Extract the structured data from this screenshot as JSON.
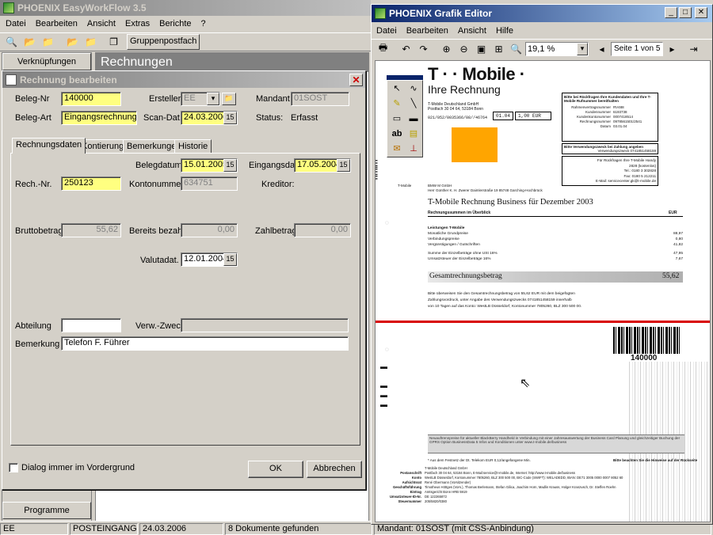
{
  "app": {
    "title": "PHOENIX EasyWorkFlow 3.5",
    "menu": [
      "Datei",
      "Bearbeiten",
      "Ansicht",
      "Extras",
      "Berichte",
      "?"
    ],
    "toolbar_label": "Gruppenpostfach",
    "sidebar_header": "Verknüpfungen",
    "sidebar_footer": "Programme",
    "panel_title": "Rechnungen",
    "status": [
      "EE",
      "POSTEINGANG",
      "24.03.2006",
      "8 Dokumente gefunden",
      "Mandant: 01SOST (mit CSS-Anbindung)"
    ]
  },
  "dialog": {
    "title": "Rechnung bearbeiten",
    "beleg_nr_label": "Beleg-Nr",
    "beleg_nr": "140000",
    "ersteller_label": "Ersteller",
    "ersteller": "EE",
    "mandant_label": "Mandant",
    "mandant": "01SOST",
    "beleg_art_label": "Beleg-Art",
    "beleg_art": "Eingangsrechnung",
    "scan_dat_label": "Scan-Dat.",
    "scan_dat": "24.03.2006",
    "status_label": "Status:",
    "status": "Erfasst",
    "tabs": [
      "Rechnungsdaten",
      "Kontierung",
      "Bemerkungen",
      "Historie"
    ],
    "belegdatum_label": "Belegdatum",
    "belegdatum": "15.01.2005",
    "eingangsdat_label": "Eingangsdat.",
    "eingangsdat": "17.05.2004",
    "rech_nr_label": "Rech.-Nr.",
    "rech_nr": "250123",
    "kontonummer_label": "Kontonummer",
    "kontonummer": "634751",
    "kreditor_label": "Kreditor:",
    "brutto_label": "Bruttobetrag",
    "brutto": "55,62",
    "bezahlt_label": "Bereits bezahlt",
    "bezahlt": "0,00",
    "zahlbetrag_label": "Zahlbetrag",
    "zahlbetrag": "0,00",
    "valutadat_label": "Valutadat.",
    "valutadat": "12.01.2004",
    "abteilung_label": "Abteilung",
    "abteilung": "",
    "verw_zweck_label": "Verw.-Zweck",
    "verw_zweck": "",
    "bemerkung_label": "Bemerkung",
    "bemerkung": "Telefon F. Führer",
    "checkbox_label": "Dialog immer im Vordergrund",
    "checkbox_checked": false,
    "ok_label": "OK",
    "cancel_label": "Abbrechen",
    "cal_glyph": "15"
  },
  "editor": {
    "title": "PHOENIX Grafik Editor",
    "menu": [
      "Datei",
      "Bearbeiten",
      "Ansicht",
      "Hilfe"
    ],
    "zoom": "19,1 %",
    "page": "Seite 1 von 5"
  },
  "invoice": {
    "brand": "T · · Mobile ·",
    "heading": "Ihre Rechnung",
    "sender": "T-Mobile Deutschland GmbH",
    "sender_addr": "Postfach 30 04 64, 53184 Bonn",
    "ref_line": "021/052/0035366/08//46764",
    "ref_box_a": "01.04",
    "ref_box_b": "1,00 EUR",
    "info_box_title": "Bitte bei Rückfragen Ihre Kundendaten und Ihre T-Mobile Rufnummer bereithalten",
    "info_rows": [
      [
        "Rahmenvertragsnummer",
        "RV488"
      ],
      [
        "Kundennummer",
        "6193738"
      ],
      [
        "Kundenkontonummer",
        "0007418514"
      ],
      [
        "Rechnungsnummer",
        "0978561501/2541"
      ],
      [
        "Datum",
        "03.01.04"
      ]
    ],
    "purpose_title": "Bitte Verwendungszweck bei Zahlung angeben",
    "purpose_value": "Verwendungszweck 0741851458159",
    "contact_lines": [
      "Für Rückfragen Ihre T-Mobile Handy",
      "2828 (kostenlos)",
      "Tel.: 0180 3 302828",
      "Fax: 0180 5 212211",
      "E-Mail: servicecenter.gk@t-mobile.de"
    ],
    "recipient_label": "T-Mobile",
    "recipient": "BMW M GmbH",
    "recipient_contact": "Herr Günther K. H. Zwerer Daimlerstraße 19 85748 Garching-Hochbrück",
    "business_title": "T-Mobile Rechnung Business für Dezember 2003",
    "summary_title": "Rechnungssummen im Überblick",
    "currency": "EUR",
    "lines": [
      [
        "Leistungen T-Mobile",
        "",
        true
      ],
      [
        "Monatliche Grundpreise",
        "88,97",
        false
      ],
      [
        "Verbindungspreise",
        "0,80",
        false
      ],
      [
        "Vergünstigungen / Gutschriften",
        "41,82",
        false
      ],
      [
        "Summe der Einzelbeträge ohne USt 16%",
        "47,95",
        false
      ],
      [
        "Umsatzsteuer der Einzelbeträge 16%",
        "7,67",
        false
      ]
    ],
    "total_label": "Gesamtrechnungsbetrag",
    "total_value": "55,62",
    "payment_text": [
      "Bitte überweisen Sie den Gesamtrechnungsbetrag von 55,62 EUR mit dem beigefügten",
      "Zahlungsvordruck, unter Angabe des Verwendungszwecks 0741851458159 innerhalb",
      "von 10 Tagen auf das Konto: WestLB Düsseldorf, Kontonummer 7805260, BLZ 300 500 00."
    ],
    "barcode_number": "140000",
    "promo_text": "Neuauftrennpreise für aktueller BlackBerry Handheld in Verbindung mit einer Jahresauswertung der Business Card Planung und gleichzeitiger Buchung der GPRS Option BusinessData 5 Infos und Konditionen unter www.t-mobile.de/business",
    "footer_note": "* Aus dem Festnetz der Dt. Telekom EUR 0,12/angefangene Min.",
    "footer_right": "Bitte beachten Sie die Hinweise auf der Rückseite",
    "footer_labels": [
      "Postanschrift",
      "Konto",
      "Aufsichtsrat",
      "Geschäftsführung",
      "Eintrag",
      "Umsatzsteuer-ID-Nr.",
      "Steuernummer"
    ],
    "footer_values": [
      "T-Mobile Deutschland GmbH",
      "Postfach 30 04 64, 53184 Bonn, E-Mail:service@t-mobile.de, Internet: http://www.t-mobile.de/business",
      "WestLB Düsseldorf, Kontonummer 7805260, BLZ 300 500 00, BIC-Code (SWIFT): WELADEDD, IBAN: DE71 3005 0000 0007 8052 60",
      "René Obermann (Vorsitzender)",
      "Timotheus Höttges (Vors.), Thomas Berlemann, Stefan Gilica, Joachim Horn, Madlin Krauss, Holger Kranzusch, Dr. Steffen Roehn",
      "Amtsgericht Bonn HRB 5919",
      "DE 122265872",
      "205/5820/0380"
    ]
  }
}
